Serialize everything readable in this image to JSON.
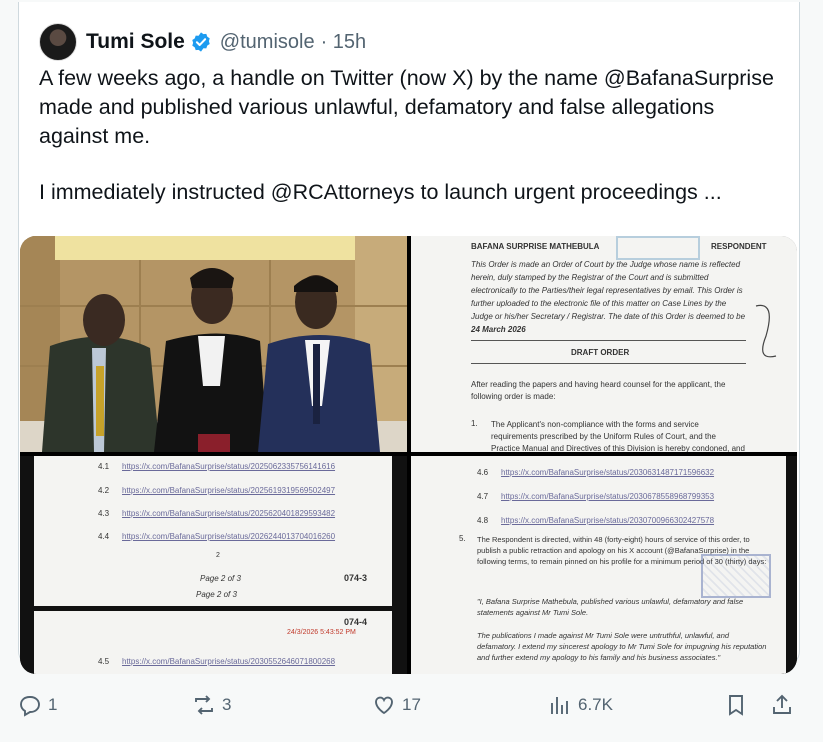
{
  "tweet": {
    "author_name": "Tumi Sole",
    "handle": "@tumisole",
    "time": "· 15h",
    "paragraph1": "A few weeks ago, a handle on Twitter (now X) by the name @BafanaSurprise made and published various unlawful, defamatory and false allegations against me.",
    "paragraph2": "I immediately instructed @RCAttorneys to launch urgent proceedings ..."
  },
  "doc_top_right": {
    "party": "BAFANA SURPRISE MATHEBULA",
    "role": "RESPONDENT",
    "order_text_1": "This Order is made an Order of Court by the Judge whose name is reflected herein, duly stamped by the Registrar of the Court and is submitted electronically to the Parties/their legal representatives by email. This Order is further uploaded to the electronic file of this matter on Case Lines by the Judge or his/her Secretary / Registrar. The date of this Order is deemed to be",
    "order_date": "24 March 2026",
    "draft_title": "DRAFT ORDER",
    "after_reading": "After reading the papers and having heard counsel for the applicant, the following order is made:",
    "item1_num": "1.",
    "item1_text": "The Applicant's non-compliance with the forms and service requirements prescribed by the Uniform Rules of Court, and the Practice Manual and Directives of this Division is hereby condoned, and this matter is dealt with as one of"
  },
  "doc_bottom_left": {
    "rows": [
      {
        "num": "4.1",
        "link": "https://x.com/BafanaSurprise/status/2025062335756141616"
      },
      {
        "num": "4.2",
        "link": "https://x.com/BafanaSurprise/status/2025619319569502497"
      },
      {
        "num": "4.3",
        "link": "https://x.com/BafanaSurprise/status/2025620401829593482"
      },
      {
        "num": "4.4",
        "link": "https://x.com/BafanaSurprise/status/2026244013704016260"
      }
    ],
    "page_number": "2",
    "page_of_1": "Page 2 of 3",
    "page_of_2": "Page 2 of 3",
    "case_ref_1": "074-3",
    "case_ref_2": "074-4",
    "stamp_time": "24/3/2026 5:43:52 PM",
    "row45_num": "4.5",
    "row45_link": "https://x.com/BafanaSurprise/status/2030552646071800268"
  },
  "doc_bottom_right": {
    "rows": [
      {
        "num": "4.6",
        "link": "https://x.com/BafanaSurprise/status/2030631487171596632"
      },
      {
        "num": "4.7",
        "link": "https://x.com/BafanaSurprise/status/2030678558968799353"
      },
      {
        "num": "4.8",
        "link": "https://x.com/BafanaSurprise/status/2030700966302427578"
      }
    ],
    "item5_num": "5.",
    "item5_text": "The Respondent is directed, within 48 (forty-eight) hours of service of this order, to publish a public retraction and apology on his X account (@BafanaSurprise) in the following terms, to remain pinned on his profile for a minimum period of 30 (thirty) days:",
    "quote1": "\"I, Bafana Surprise Mathebula, published various unlawful, defamatory and false statements against Mr Tumi Sole.",
    "quote2": "The publications I made against Mr Tumi Sole were untruthful, unlawful, and defamatory. I extend my sincerest apology to Mr Tumi Sole for impugning his reputation and further extend my apology to his family and his business associates.\""
  },
  "actions": {
    "replies": "1",
    "reposts": "3",
    "likes": "17",
    "views": "6.7K"
  },
  "colors": {
    "verified_blue": "#1d9bf0",
    "muted": "#536471",
    "border": "#cfd9de"
  }
}
